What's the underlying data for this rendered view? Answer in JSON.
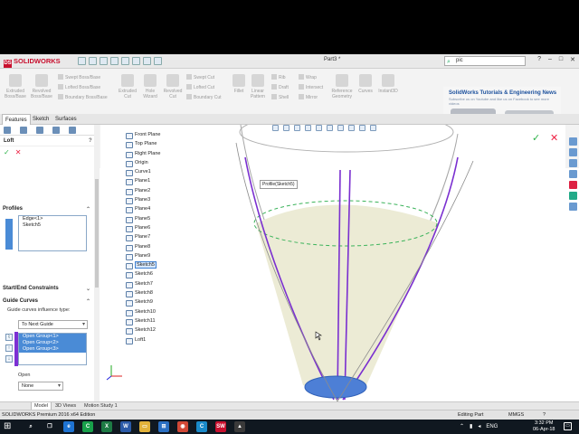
{
  "app": {
    "logo_ds": "DS",
    "logo_text": "SOLIDWORKS",
    "document_title": "Part3 *",
    "search_value": "pic",
    "window_buttons": [
      "?",
      "–",
      "□",
      "✕"
    ]
  },
  "ribbon": {
    "features": [
      {
        "label": "Extruded Boss/Base"
      },
      {
        "label": "Revolved Boss/Base"
      },
      {
        "label": "Extruded Cut"
      },
      {
        "label": "Hole Wizard"
      },
      {
        "label": "Revolved Cut"
      },
      {
        "label": "Fillet"
      },
      {
        "label": "Linear Pattern"
      },
      {
        "label": "Reference Geometry"
      },
      {
        "label": "Curves"
      },
      {
        "label": "Instant3D"
      }
    ],
    "small_items": [
      {
        "label": "Swept Boss/Base"
      },
      {
        "label": "Lofted Boss/Base"
      },
      {
        "label": "Boundary Boss/Base"
      },
      {
        "label": "Swept Cut"
      },
      {
        "label": "Lofted Cut"
      },
      {
        "label": "Boundary Cut"
      },
      {
        "label": "Rib"
      },
      {
        "label": "Draft"
      },
      {
        "label": "Shell"
      },
      {
        "label": "Wrap"
      },
      {
        "label": "Intersect"
      },
      {
        "label": "Mirror"
      }
    ]
  },
  "ad": {
    "title": "SolidWorks Tutorials & Engineering News",
    "subtitle": "Subscribe us on Youtube and like us on Facebook to see more videos"
  },
  "command_tabs": [
    "Features",
    "Sketch",
    "Surfaces"
  ],
  "property_manager": {
    "title": "Loft",
    "help": "?",
    "ok": "✓",
    "cancel": "✕",
    "profiles_header": "Profiles",
    "profiles": [
      "Edge<1>",
      "Sketch5"
    ],
    "constraints_header": "Start/End Constraints",
    "guide_header": "Guide Curves",
    "guide_influence_label": "Guide curves influence type:",
    "guide_influence_value": "To Next Guide",
    "guides": [
      "Open Group<1>",
      "Open Group<2>",
      "Open Group<3>"
    ],
    "open_label": "Open",
    "open_value": "None"
  },
  "feature_tree": [
    {
      "label": "Front Plane"
    },
    {
      "label": "Top Plane"
    },
    {
      "label": "Right Plane"
    },
    {
      "label": "Origin"
    },
    {
      "label": "Curve1"
    },
    {
      "label": "Plane1"
    },
    {
      "label": "Plane2"
    },
    {
      "label": "Plane3"
    },
    {
      "label": "Plane4"
    },
    {
      "label": "Plane5"
    },
    {
      "label": "Plane6"
    },
    {
      "label": "Plane7"
    },
    {
      "label": "Plane8"
    },
    {
      "label": "Plane9"
    },
    {
      "label": "Sketch5",
      "selected": true
    },
    {
      "label": "Sketch6"
    },
    {
      "label": "Sketch7"
    },
    {
      "label": "Sketch8"
    },
    {
      "label": "Sketch9"
    },
    {
      "label": "Sketch10"
    },
    {
      "label": "Sketch11"
    },
    {
      "label": "Sketch12"
    },
    {
      "label": "Loft1"
    }
  ],
  "viewport": {
    "callout": "Profile(Sketch5)",
    "surface_color": "#ecebd5",
    "guide_color": "#7a2fd0",
    "outline_color": "#9a9a9a"
  },
  "bottom_tabs": [
    "Model",
    "3D Views",
    "Motion Study 1"
  ],
  "status": {
    "left": "SOLIDWORKS Premium 2016 x64 Edition",
    "mode": "Editing Part",
    "units": "MMGS"
  },
  "taskbar": {
    "start_icon": "windows-icon",
    "apps": [
      {
        "name": "search",
        "glyph": "⌕",
        "color": "#101820"
      },
      {
        "name": "task-view",
        "glyph": "❐",
        "color": "#101820"
      },
      {
        "name": "edge",
        "glyph": "e",
        "color": "#1e73d2"
      },
      {
        "name": "camtasia",
        "glyph": "C",
        "color": "#18a04a"
      },
      {
        "name": "excel",
        "glyph": "X",
        "color": "#1d7a44"
      },
      {
        "name": "word",
        "glyph": "W",
        "color": "#2b5aa8"
      },
      {
        "name": "explorer",
        "glyph": "▭",
        "color": "#e2b23a"
      },
      {
        "name": "store",
        "glyph": "⊞",
        "color": "#2a6fc2"
      },
      {
        "name": "chrome",
        "glyph": "◉",
        "color": "#d14836"
      },
      {
        "name": "camtasia2",
        "glyph": "C",
        "color": "#1a8ac9"
      },
      {
        "name": "solidworks",
        "glyph": "SW",
        "color": "#c8102e"
      },
      {
        "name": "photos",
        "glyph": "▲",
        "color": "#3a3a3a"
      }
    ],
    "language": "ENG",
    "time": "3:32 PM",
    "date": "06-Apr-18"
  }
}
